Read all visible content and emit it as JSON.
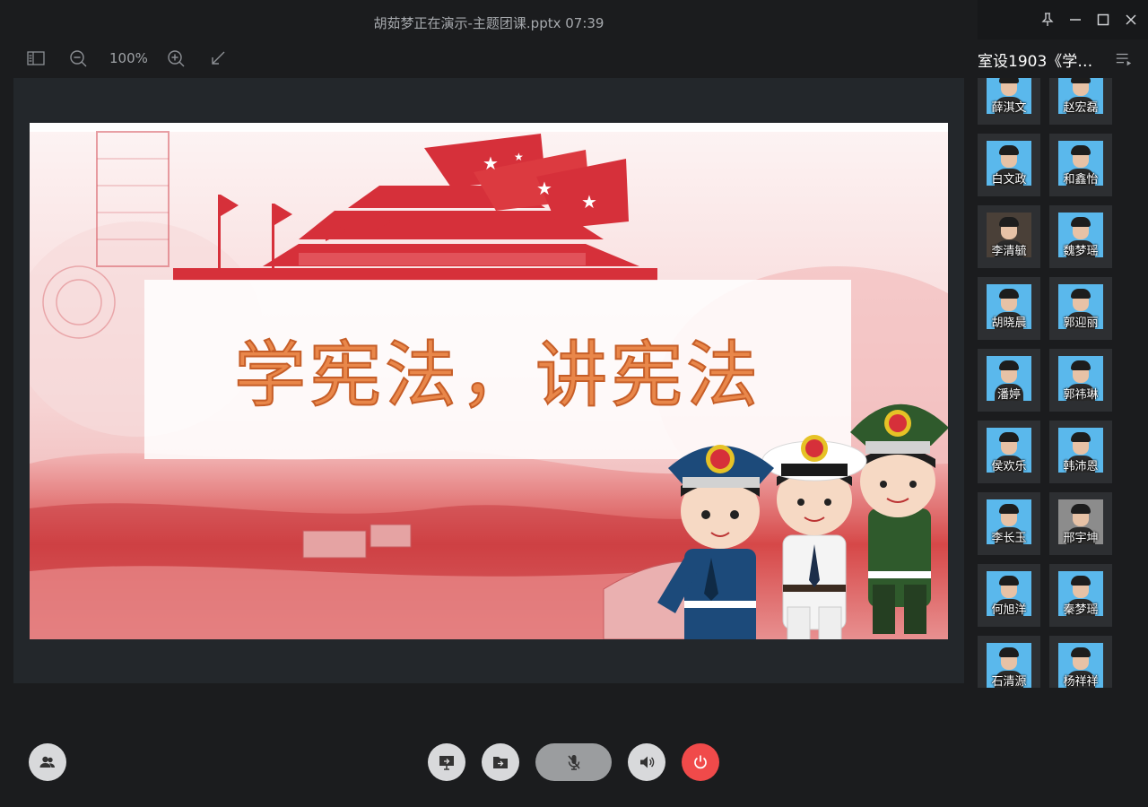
{
  "window": {
    "title": "胡茹梦正在演示-主题团课.pptx 07:39",
    "controls": [
      "pin-icon",
      "minimize-icon",
      "maximize-icon",
      "close-icon"
    ]
  },
  "toolbar": {
    "zoom_level": "100%",
    "icons": [
      "sidebar-toggle-icon",
      "zoom-out-icon",
      "zoom-in-icon",
      "exit-fullscreen-icon"
    ]
  },
  "slide": {
    "headline": "学宪法，讲宪法",
    "accent_color": "#e9874a"
  },
  "panel": {
    "room_name": "室设1903《学宪...",
    "participants": [
      {
        "name": "薛淇文",
        "avatar": "blue"
      },
      {
        "name": "赵宏磊",
        "avatar": "blue"
      },
      {
        "name": "白文政",
        "avatar": "blue"
      },
      {
        "name": "和鑫怡",
        "avatar": "blue"
      },
      {
        "name": "李清毓",
        "avatar": "photo"
      },
      {
        "name": "魏梦瑶",
        "avatar": "blue"
      },
      {
        "name": "胡晓晨",
        "avatar": "blue"
      },
      {
        "name": "郭迎丽",
        "avatar": "blue"
      },
      {
        "name": "潘婷",
        "avatar": "blue"
      },
      {
        "name": "郭祎琳",
        "avatar": "blue"
      },
      {
        "name": "侯欢乐",
        "avatar": "blue"
      },
      {
        "name": "韩沛恩",
        "avatar": "blue"
      },
      {
        "name": "李长玉",
        "avatar": "blue"
      },
      {
        "name": "邢宇坤",
        "avatar": "gray"
      },
      {
        "name": "何旭洋",
        "avatar": "blue"
      },
      {
        "name": "秦梦瑶",
        "avatar": "blue"
      },
      {
        "name": "石清源",
        "avatar": "blue"
      },
      {
        "name": "杨祥祥",
        "avatar": "blue"
      }
    ]
  },
  "controls": {
    "items": [
      "members-icon",
      "share-screen-icon",
      "share-file-icon",
      "mic-muted-icon",
      "speaker-icon",
      "leave-icon"
    ],
    "leave_color": "#f04a4a"
  }
}
